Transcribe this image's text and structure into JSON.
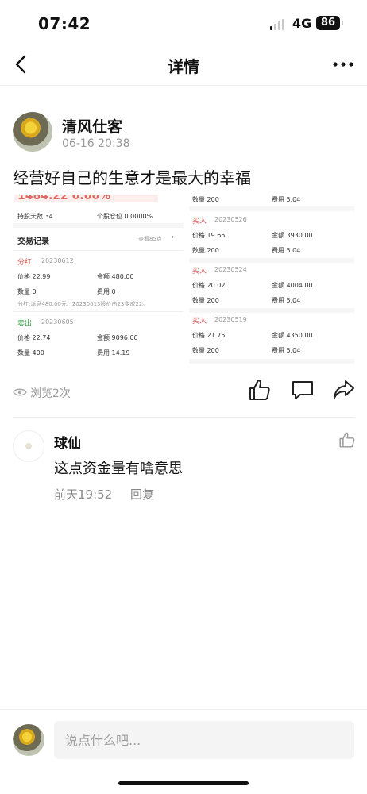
{
  "status_bar": {
    "time": "07:42",
    "network": "4G",
    "battery": "86"
  },
  "nav": {
    "title": "详情",
    "back_icon": "chevron-left-icon",
    "more_icon": "more-horizontal-icon"
  },
  "post": {
    "author": "清风仕客",
    "time": "06-16 20:38",
    "text": "经营好自己的生意才是最大的幸福",
    "image": {
      "left": {
        "header_value": "1484.22 0.00%",
        "hold_days_label": "持股天数 34",
        "position_ratio_label": "个股仓位 0.0000%",
        "records_title": "交易记录",
        "view_all": "查看85点",
        "trades": [
          {
            "type": "分红",
            "date": "20230612",
            "price": "价格 22.99",
            "amount": "金额 480.00",
            "qty": "数量 0",
            "fee": "费用 0",
            "note": "分红:派息480.00元。20230613股价由23变成22。"
          },
          {
            "type": "卖出",
            "date": "20230605",
            "price": "价格 22.74",
            "amount": "金额 9096.00",
            "qty": "数量 400",
            "fee": "费用 14.19"
          }
        ]
      },
      "right": {
        "top_qty": "数量 200",
        "top_fee": "费用 5.04",
        "trades": [
          {
            "type": "买入",
            "date": "20230526",
            "price": "价格 19.65",
            "amount": "金额 3930.00",
            "qty": "数量 200",
            "fee": "费用 5.04"
          },
          {
            "type": "买入",
            "date": "20230524",
            "price": "价格 20.02",
            "amount": "金额 4004.00",
            "qty": "数量 200",
            "fee": "费用 5.04"
          },
          {
            "type": "买入",
            "date": "20230519",
            "price": "价格 21.75",
            "amount": "金额 4350.00",
            "qty": "数量 200",
            "fee": "费用 5.04"
          }
        ]
      }
    },
    "views": "浏览2次",
    "actions": {
      "like_icon": "thumbs-up-icon",
      "comment_icon": "comment-icon",
      "share_icon": "share-icon"
    }
  },
  "comments": [
    {
      "author": "球仙",
      "text": "这点资金量有啥意思",
      "time": "前天19:52",
      "reply_label": "回复",
      "like_icon": "thumbs-up-icon"
    }
  ],
  "input": {
    "placeholder": "说点什么吧..."
  },
  "colors": {
    "buy_red": "#d9534f",
    "sell_green": "#2e9e44",
    "muted": "#999999"
  }
}
